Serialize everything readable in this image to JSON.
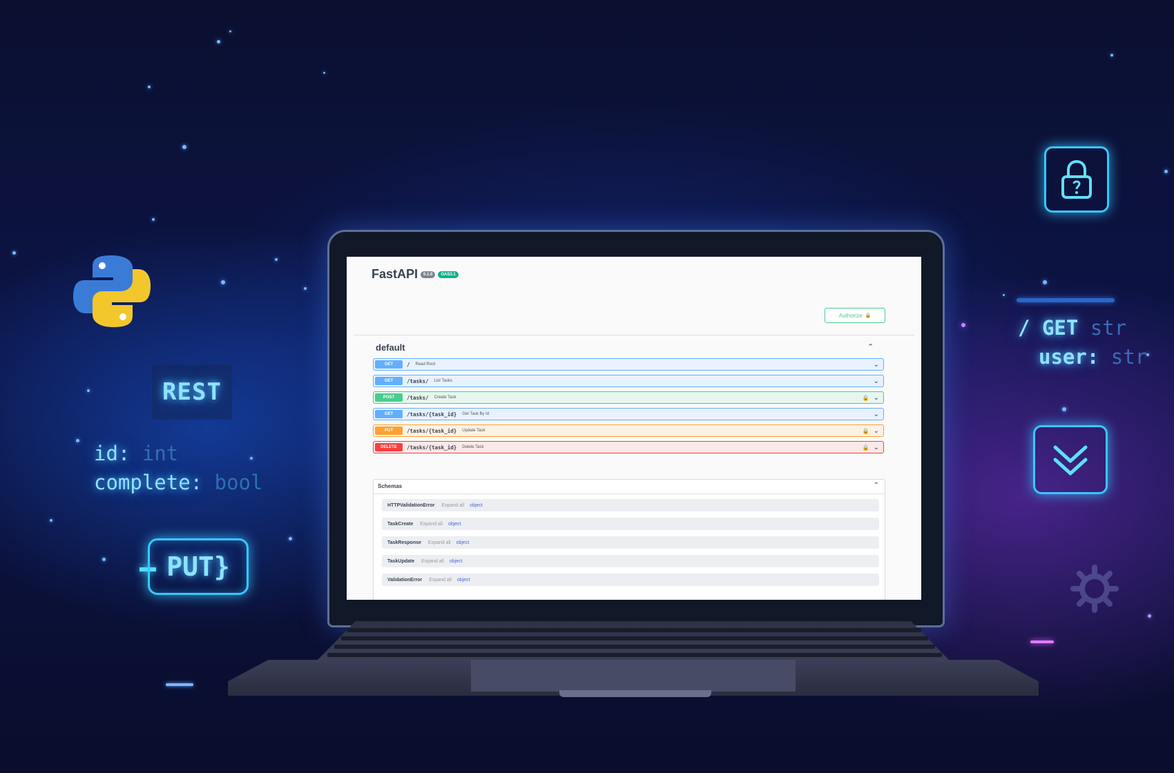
{
  "left_code": {
    "rest_label": "REST",
    "lines": [
      {
        "key": "id:",
        "type": "int"
      },
      {
        "key": "complete:",
        "type": "bool"
      }
    ],
    "put_label": "PUT}"
  },
  "right_code": {
    "line1_slash": "/",
    "line1_method": "GET",
    "line1_type": "str",
    "line2_key": "user:",
    "line2_type": "str"
  },
  "icons": [
    "python-logo",
    "lock-icon",
    "chevron-down-icon",
    "gear-icon"
  ],
  "colors": {
    "accent_glow": "#38c8ff",
    "get": "#61affe",
    "post": "#49cc90",
    "put": "#fca130",
    "delete": "#f93e3e"
  },
  "swagger": {
    "title": "FastAPI",
    "version_badge": "0.1.0",
    "oas_badge": "OAS3.1",
    "authorize_label": "Authorize",
    "section_title": "default",
    "operations": [
      {
        "method": "GET",
        "path": "/",
        "summary": "Read Root",
        "locked": false
      },
      {
        "method": "GET",
        "path": "/tasks/",
        "summary": "List Tasks",
        "locked": false
      },
      {
        "method": "POST",
        "path": "/tasks/",
        "summary": "Create Task",
        "locked": true
      },
      {
        "method": "GET",
        "path": "/tasks/{task_id}",
        "summary": "Get Task By Id",
        "locked": false
      },
      {
        "method": "PUT",
        "path": "/tasks/{task_id}",
        "summary": "Update Task",
        "locked": true
      },
      {
        "method": "DELETE",
        "path": "/tasks/{task_id}",
        "summary": "Delete Task",
        "locked": true
      }
    ],
    "schemas_title": "Schemas",
    "schemas": [
      {
        "name": "HTTPValidationError",
        "desc": "Expand all",
        "type": "object"
      },
      {
        "name": "TaskCreate",
        "desc": "Expand all",
        "type": "object"
      },
      {
        "name": "TaskResponse",
        "desc": "Expand all",
        "type": "object"
      },
      {
        "name": "TaskUpdate",
        "desc": "Expand all",
        "type": "object"
      },
      {
        "name": "ValidationError",
        "desc": "Expand all",
        "type": "object"
      }
    ]
  }
}
